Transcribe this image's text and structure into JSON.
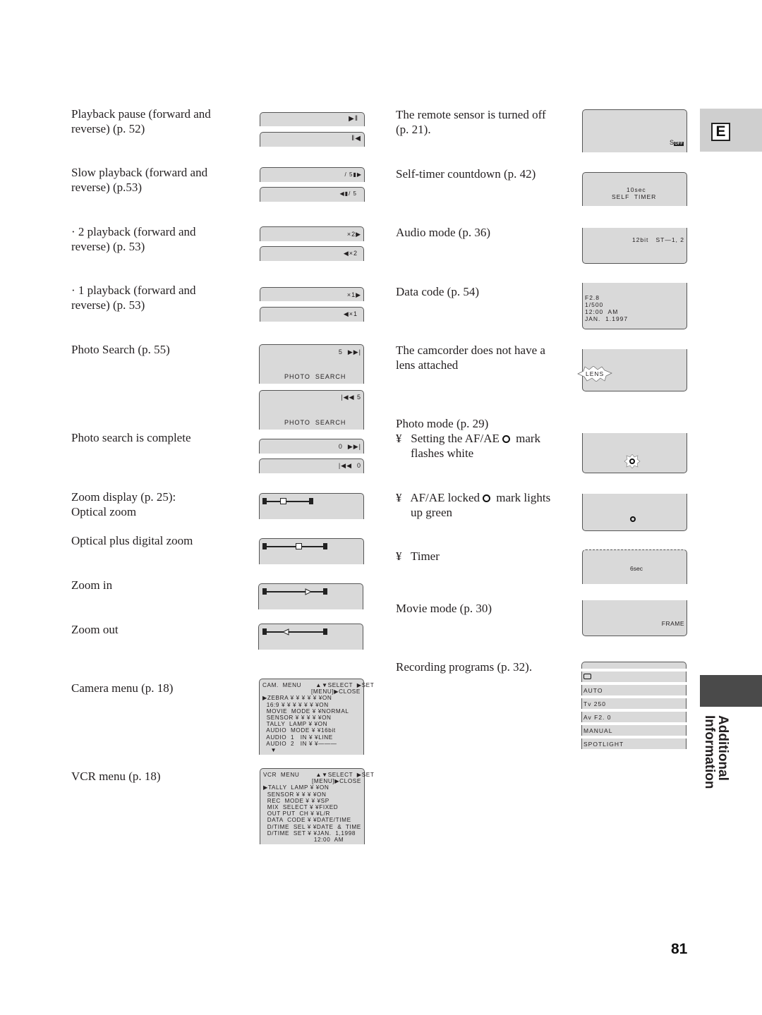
{
  "left_column": [
    {
      "label": "Playback pause (forward and reverse) (p. 52)",
      "lines": [
        "Playback pause (forward and",
        "reverse) (p. 52)"
      ]
    },
    {
      "label": "Slow playback",
      "lines": [
        "Slow playback (forward and",
        "reverse) (p.53)"
      ]
    },
    {
      "label": "x2 playback",
      "lines": [
        "· 2 playback (forward and",
        "reverse) (p. 53)"
      ]
    },
    {
      "label": "x1 playback",
      "lines": [
        "· 1 playback (forward and",
        "reverse) (p. 53)"
      ]
    },
    {
      "label": "Photo search",
      "lines": [
        "Photo Search (p. 55)"
      ]
    },
    {
      "label": "Photo search complete",
      "lines": [
        "Photo search is complete"
      ]
    },
    {
      "label": "Zoom display",
      "lines": [
        "Zoom display (p. 25):",
        "Optical zoom"
      ]
    },
    {
      "label": "Optical plus digital",
      "lines": [
        "Optical plus digital zoom"
      ]
    },
    {
      "label": "Zoom in",
      "lines": [
        "Zoom in"
      ]
    },
    {
      "label": "Zoom out",
      "lines": [
        "Zoom out"
      ]
    },
    {
      "label": "Camera menu",
      "lines": [
        "Camera menu (p. 18)"
      ]
    },
    {
      "label": "VCR menu",
      "lines": [
        "VCR menu (p. 18)"
      ]
    }
  ],
  "left_screens": {
    "pause_fwd": "▶‖",
    "pause_rev": "‖◀",
    "slow_fwd": "/ 5▮▶",
    "slow_rev": "◀▮/ 5",
    "x2_fwd": "×2▶",
    "x2_rev": "◀×2",
    "x1_fwd": "×1▶",
    "x1_rev": "◀×1",
    "search_fwd_count": "5  ▶▶|",
    "search_rev_count": "|◀◀ 5",
    "search_label": "PHOTO  SEARCH",
    "complete_fwd": "0  ▶▶|",
    "complete_rev": "|◀◀  0",
    "zoom_optical_position": 0.35,
    "zoom_digital_position": 0.55,
    "zoom_in_position": 0.72,
    "zoom_out_position": 0.3
  },
  "camera_menu": {
    "lines": [
      "CAM.  MENU       ▲▼SELECT  ▶SET",
      "                        [MENU]▶CLOSE",
      "▶ZEBRA ¥ ¥ ¥ ¥ ¥ ¥ON",
      "  16:9 ¥ ¥ ¥ ¥ ¥ ¥ ¥ON",
      "  MOVIE  MODE ¥ ¥NORMAL",
      "  SENSOR ¥ ¥ ¥ ¥ ¥ON",
      "  TALLY  LAMP ¥ ¥ON",
      "  AUDIO  MODE ¥ ¥16bit",
      "  AUDIO  1   IN ¥ ¥LINE",
      "  AUDIO  2   IN ¥ ¥———",
      "    ▼"
    ]
  },
  "vcr_menu": {
    "lines": [
      "VCR  MENU        ▲▼SELECT  ▶SET",
      "                        [MENU]▶CLOSE",
      "▶TALLY  LAMP ¥ ¥ON",
      "  SENSOR ¥ ¥ ¥ ¥ON",
      "  REC  MODE ¥ ¥ ¥SP",
      "  MIX  SELECT ¥ ¥FIXED",
      "  OUT PUT  CH ¥ ¥L/R",
      "  DATA  CODE ¥ ¥DATE/TIME",
      "  D/TIME  SEL ¥ ¥DATE  &  TIME",
      "  D/TIME  SET ¥ ¥JAN.  1,1998",
      "                         12:00  AM"
    ]
  },
  "right_column": [
    {
      "lines": [
        "The remote sensor is turned off",
        "(p. 21)."
      ]
    },
    {
      "lines": [
        "Self-timer countdown (p. 42)"
      ]
    },
    {
      "lines": [
        "Audio mode (p. 36)"
      ]
    },
    {
      "lines": [
        "Data code (p. 54)"
      ]
    },
    {
      "lines": [
        "The camcorder does not have a",
        "lens attached"
      ]
    },
    {
      "lines": [
        "Photo mode (p. 29)"
      ]
    },
    {
      "bullet": "¥",
      "text_before": "Setting the AF/AE",
      "text_after": "mark",
      "line2": "flashes white"
    },
    {
      "bullet": "¥",
      "text_before": "AF/AE locked",
      "text_after": "mark lights",
      "line2": "up green"
    },
    {
      "bullet": "¥",
      "text_before": "Timer"
    },
    {
      "lines": [
        "Movie mode (p. 30)"
      ]
    },
    {
      "lines": [
        "Recording programs (p. 32)."
      ]
    }
  ],
  "right_screens": {
    "sensor_off": "S",
    "sensor_off_badge": "OFF",
    "self_timer_sec": "10sec",
    "self_timer_label": "SELF  TIMER",
    "audio_mode": "12bit   ST—1, 2",
    "data_code": [
      "F2.8",
      "1/500",
      "12:00  AM",
      "JAN.  1.1997"
    ],
    "lens_warning": "LENS",
    "timer": "6sec",
    "movie_mode": "FRAME",
    "recording_programs": [
      "▭",
      "AUTO",
      "Tv  250",
      "Av  F2. 0",
      "MANUAL",
      "SPOTLIGHT"
    ]
  },
  "side_tabs": {
    "language": "E",
    "section_line1": "Additional",
    "section_line2": "Information"
  },
  "page_number": "81"
}
